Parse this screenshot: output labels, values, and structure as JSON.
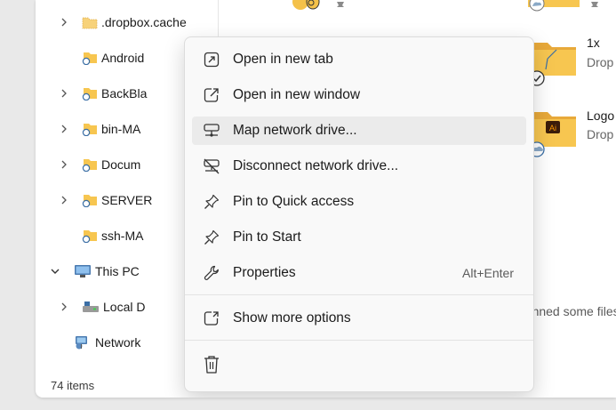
{
  "nav": {
    "items": [
      {
        "label": ".dropbox.cache",
        "chevron": true
      },
      {
        "label": "Android",
        "chevron": false
      },
      {
        "label": "BackBla",
        "chevron": true
      },
      {
        "label": "bin-MA",
        "chevron": true
      },
      {
        "label": "Docum",
        "chevron": true
      },
      {
        "label": "SERVER",
        "chevron": true
      },
      {
        "label": "ssh-MA",
        "chevron": false
      }
    ],
    "this_pc": "This PC",
    "local_disk": "Local D",
    "network": "Network"
  },
  "status": {
    "item_count": "74 items"
  },
  "content": {
    "items": [
      {
        "name": "1x",
        "sub": "Drop"
      },
      {
        "name": "Logo",
        "sub": "Drop"
      }
    ],
    "hint": "e pinned some files, G"
  },
  "context_menu": {
    "items": [
      {
        "label": "Open in new tab",
        "icon": "open-new-tab-icon"
      },
      {
        "label": "Open in new window",
        "icon": "open-new-window-icon"
      },
      {
        "label": "Map network drive...",
        "icon": "map-network-drive-icon"
      },
      {
        "label": "Disconnect network drive...",
        "icon": "disconnect-network-drive-icon"
      },
      {
        "label": "Pin to Quick access",
        "icon": "pin-icon"
      },
      {
        "label": "Pin to Start",
        "icon": "pin-icon"
      },
      {
        "label": "Properties",
        "icon": "wrench-icon",
        "shortcut": "Alt+Enter"
      },
      {
        "label": "Show more options",
        "icon": "show-more-icon"
      }
    ],
    "hovered_index": 2
  },
  "colors": {
    "folder": "#f7c650",
    "folder_dark": "#e8a93a",
    "accent": "#0067c0",
    "menu_bg": "#f9f9f9",
    "hover_bg": "#ebebeb"
  }
}
